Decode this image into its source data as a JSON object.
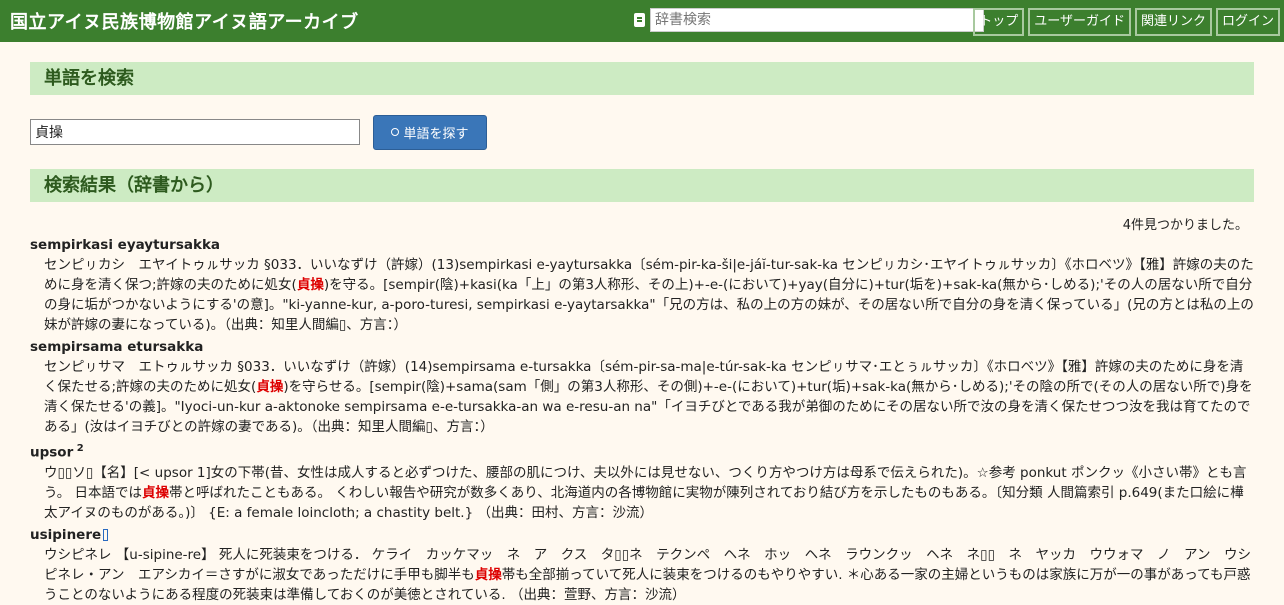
{
  "header": {
    "site_title": "国立アイヌ民族博物館アイヌ語アーカイブ",
    "search_placeholder": "辞書検索",
    "nav": [
      "トップ",
      "ユーザーガイド",
      "関連リンク",
      "ログイン"
    ]
  },
  "search_section": {
    "title": "単語を検索",
    "query": "貞操",
    "button_label": "単語を探す"
  },
  "results_section": {
    "title": "検索結果（辞書から）",
    "count_text": "4件見つかりました。",
    "highlight": "貞操",
    "entries": [
      {
        "headword": "sempirkasi eyaytursakka",
        "sup": "",
        "body_parts": [
          "センピㇼカシ　エヤイトゥㇽサッカ §033．いいなずけ（許嫁）(13)sempirkasi e-yaytursakka〔sém-pir-ka-ši|e-jáĭ-tur-sak-ka センピㇼカシ･エヤイトゥㇽサッカ〕《ホロベツ》【雅】許嫁の夫のために身を清く保つ;許嫁の夫のために処女(",
          "貞操",
          ")を守る。[sempir(陰)+kasi(ka「上」の第3人称形、その上)+-e-(において)+yay(自分に)+tur(垢を)+sak-ka(無から･しめる);'その人の居ない所で自分の身に垢がつかないようにする'の意]。\"ki-yanne-kur, a-poro-turesi, sempirkasi e-yaytarsakka\"「兄の方は、私の上の方の妹が、その居ない所で自分の身を清く保っている」(兄の方とは私の上の妹が許嫁の妻になっている)。（出典：知里人間編▯、方言：）"
        ]
      },
      {
        "headword": "sempirsama etursakka",
        "sup": "",
        "body_parts": [
          "センピㇼサマ　エトゥㇽサッカ §033．いいなずけ（許嫁）(14)sempirsama e-tursakka〔sém-pir-sa-ma|e-túr-sak-ka センピㇼサマ･エとぅㇽサッカ〕《ホロベツ》【雅】許嫁の夫のために身を清く保たせる;許嫁の夫のために処女(",
          "貞操",
          ")を守らせる。[sempir(陰)+sama(sam「側」の第3人称形、その側)+-e-(において)+tur(垢)+sak-ka(無から･しめる);'その陰の所で(その人の居ない所で)身を清く保たせる'の義]。\"Iyoci-un-kur a-aktonoke sempirsama e-e-tursakka-an wa e-resu-an na\"「イヨチびとである我が弟御のためにその居ない所で汝の身を清く保たせつつ汝を我は育てたのである」(汝はイヨチびとの許嫁の妻である)。（出典：知里人間編▯、方言：）"
        ]
      },
      {
        "headword": "upsor",
        "sup": "2",
        "body_parts": [
          "ウ▯▯ソ▯【名】[< upsor 1]女の下帯(昔、女性は成人すると必ずつけた、腰部の肌につけ、夫以外には見せない、つくり方やつけ方は母系で伝えられた)。☆参考 ponkut ポンクッ《小さい帯》とも言う。 日本語では",
          "貞操",
          "帯と呼ばれたこともある。 くわしい報告や研究が数多くあり、北海道内の各博物館に実物が陳列されており結び方を示したものもある。〔知分類 人間篇索引 p.649(また口絵に樺太アイヌのものがある。)〕 {E: a female loincloth; a chastity belt.} （出典：田村、方言：沙流）"
        ]
      },
      {
        "headword": "usipinere",
        "sup": "",
        "body_parts": [
          "ウシピネレ 【u-sipine-re】 死人に死装束をつける． ケライ　カッケマッ　ネ　ア　クス　タ▯▯ネ　テクンペ　ヘネ　ホッ　ヘネ　ラウンクッ　ヘネ　ネ▯▯　ネ　ヤッカ　ウウォマ　ノ　アン　ウシピネレ・アン　エアシカイ＝さすがに淑女であっただけに手甲も脚半も",
          "貞操",
          "帯も全部揃っていて死人に装束をつけるのもやりやすい. ＊心ある一家の主婦というものは家族に万が一の事があっても戸惑うことのないようにある程度の死装束は準備しておくのが美徳とされている. （出典：萱野、方言：沙流）"
        ]
      }
    ]
  }
}
